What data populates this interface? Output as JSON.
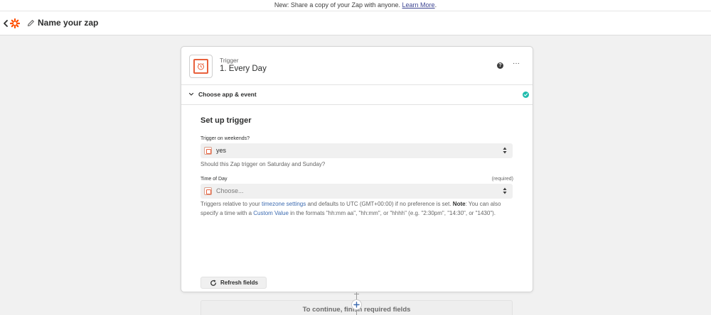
{
  "banner": {
    "text": "New: Share a copy of your Zap with anyone.",
    "link": "Learn More",
    "suffix": "."
  },
  "topbar": {
    "zap_name": "Name your zap",
    "icons": [
      "chevron-left-icon",
      "zapier-logo-icon",
      "pencil-icon"
    ]
  },
  "step": {
    "type": "Trigger",
    "title": "1. Every Day",
    "icons": [
      "alarm-clock-icon",
      "help-icon",
      "more-options-icon"
    ]
  },
  "section": {
    "label": "Choose app & event",
    "status": "complete"
  },
  "form": {
    "title": "Set up trigger",
    "weekends": {
      "label": "Trigger on weekends?",
      "value": "yes",
      "hint": "Should this Zap trigger on Saturday and Sunday?"
    },
    "time_of_day": {
      "label": "Time of Day",
      "required": "(required)",
      "placeholder": "Choose...",
      "hint_1": "Triggers relative to your",
      "hint_link_1": "timezone settings",
      "hint_2": "and defaults to UTC (GMT+00:00) if no preference is set.",
      "hint_note": "Note",
      "hint_3": ": You can also specify a time with a",
      "hint_link_2": "Custom Value",
      "hint_4": "in the formats \"hh:mm aa\", \"hh:mm\", or \"hhhh\" (e.g. \"2:30pm\", \"14:30\", or \"1430\")."
    },
    "refresh_label": "Refresh fields",
    "continue_label": "To continue, finish required fields"
  },
  "colors": {
    "accent_orange": "#e8603c",
    "success_teal": "#1fbcad",
    "link_blue": "#3b6ab0"
  }
}
